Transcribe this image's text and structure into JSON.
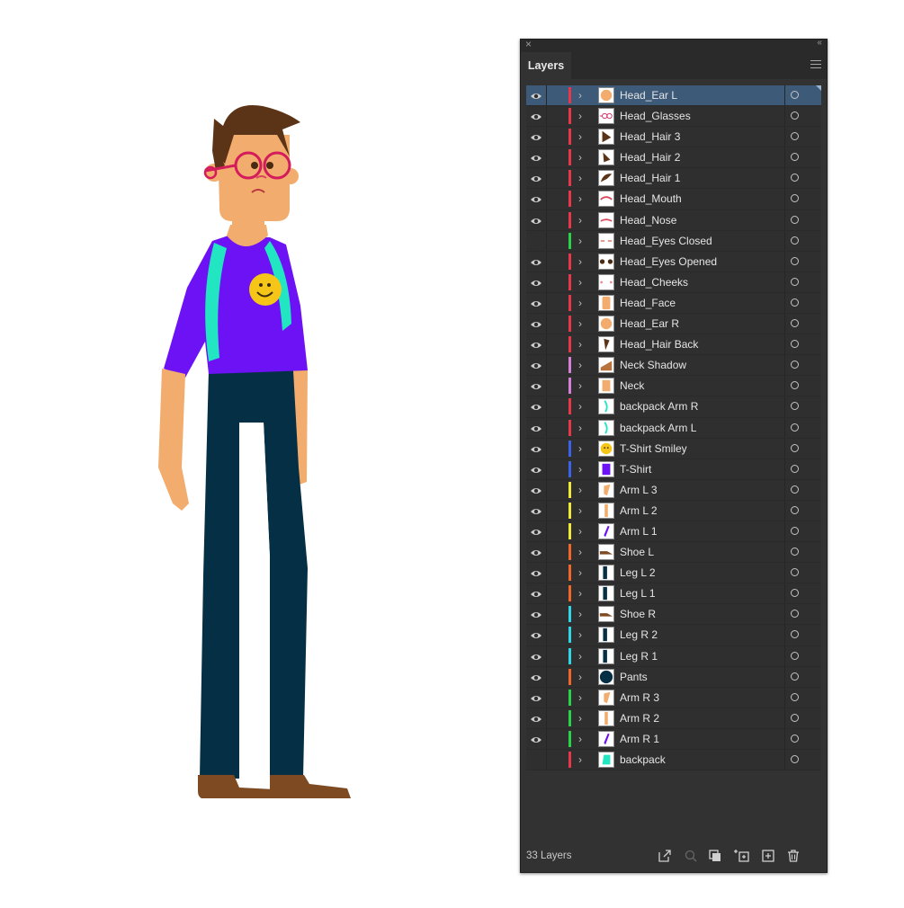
{
  "panel": {
    "tab_label": "Layers",
    "layer_count": "33 Layers"
  },
  "layers": [
    {
      "name": "Head_Ear L",
      "visible": true,
      "color": "#e8374a",
      "thumb": "ear",
      "selected": true
    },
    {
      "name": "Head_Glasses",
      "visible": true,
      "color": "#e8374a",
      "thumb": "glasses"
    },
    {
      "name": "Head_Hair 3",
      "visible": true,
      "color": "#e8374a",
      "thumb": "hair3"
    },
    {
      "name": "Head_Hair 2",
      "visible": true,
      "color": "#e8374a",
      "thumb": "hair2"
    },
    {
      "name": "Head_Hair 1",
      "visible": true,
      "color": "#e8374a",
      "thumb": "hair1"
    },
    {
      "name": "Head_Mouth",
      "visible": true,
      "color": "#e8374a",
      "thumb": "mouth"
    },
    {
      "name": "Head_Nose",
      "visible": true,
      "color": "#e8374a",
      "thumb": "nose"
    },
    {
      "name": "Head_Eyes Closed",
      "visible": false,
      "color": "#28d34a",
      "thumb": "eyesclosed"
    },
    {
      "name": "Head_Eyes Opened",
      "visible": true,
      "color": "#e8374a",
      "thumb": "eyesopened"
    },
    {
      "name": "Head_Cheeks",
      "visible": true,
      "color": "#e8374a",
      "thumb": "cheeks"
    },
    {
      "name": "Head_Face",
      "visible": true,
      "color": "#e8374a",
      "thumb": "face"
    },
    {
      "name": "Head_Ear R",
      "visible": true,
      "color": "#e8374a",
      "thumb": "ear"
    },
    {
      "name": "Head_Hair Back",
      "visible": true,
      "color": "#e8374a",
      "thumb": "hairback"
    },
    {
      "name": "Neck Shadow",
      "visible": true,
      "color": "#d67fd6",
      "thumb": "neckshadow"
    },
    {
      "name": "Neck",
      "visible": true,
      "color": "#d67fd6",
      "thumb": "neck"
    },
    {
      "name": "backpack Arm R",
      "visible": true,
      "color": "#e8374a",
      "thumb": "bparm"
    },
    {
      "name": "backpack Arm L",
      "visible": true,
      "color": "#e8374a",
      "thumb": "bparm"
    },
    {
      "name": "T-Shirt Smiley",
      "visible": true,
      "color": "#3b63e8",
      "thumb": "smiley"
    },
    {
      "name": "T-Shirt",
      "visible": true,
      "color": "#3b63e8",
      "thumb": "tshirt"
    },
    {
      "name": "Arm L 3",
      "visible": true,
      "color": "#f0e93a",
      "thumb": "arm3"
    },
    {
      "name": "Arm L 2",
      "visible": true,
      "color": "#f0e93a",
      "thumb": "arm2"
    },
    {
      "name": "Arm L 1",
      "visible": true,
      "color": "#f0e93a",
      "thumb": "arm1"
    },
    {
      "name": "Shoe L",
      "visible": true,
      "color": "#f0672a",
      "thumb": "shoe"
    },
    {
      "name": "Leg L 2",
      "visible": true,
      "color": "#f0672a",
      "thumb": "leg"
    },
    {
      "name": "Leg L 1",
      "visible": true,
      "color": "#f0672a",
      "thumb": "leg"
    },
    {
      "name": "Shoe R",
      "visible": true,
      "color": "#2fd6e8",
      "thumb": "shoe"
    },
    {
      "name": "Leg R 2",
      "visible": true,
      "color": "#2fd6e8",
      "thumb": "leg"
    },
    {
      "name": "Leg R 1",
      "visible": true,
      "color": "#2fd6e8",
      "thumb": "leg"
    },
    {
      "name": "Pants",
      "visible": true,
      "color": "#f0672a",
      "thumb": "pants"
    },
    {
      "name": "Arm R 3",
      "visible": true,
      "color": "#28d34a",
      "thumb": "arm3"
    },
    {
      "name": "Arm R 2",
      "visible": true,
      "color": "#28d34a",
      "thumb": "arm2"
    },
    {
      "name": "Arm R 1",
      "visible": true,
      "color": "#28d34a",
      "thumb": "arm1"
    },
    {
      "name": "backpack",
      "visible": false,
      "color": "#e8374a",
      "thumb": "backpack"
    }
  ],
  "colors": {
    "skin": "#f2ad6e",
    "hair": "#5b3418",
    "shirt": "#6d12f5",
    "backpack": "#21e6c1",
    "pants": "#052f44",
    "shoes": "#7d4a22",
    "glasses": "#d41c5c",
    "smiley": "#f5c518",
    "panel_bg": "#323232",
    "selection": "#3d5a78"
  },
  "footer_icons": [
    "export-icon",
    "search-icon",
    "clipping-mask-icon",
    "new-sublayer-icon",
    "new-layer-icon",
    "trash-icon"
  ]
}
